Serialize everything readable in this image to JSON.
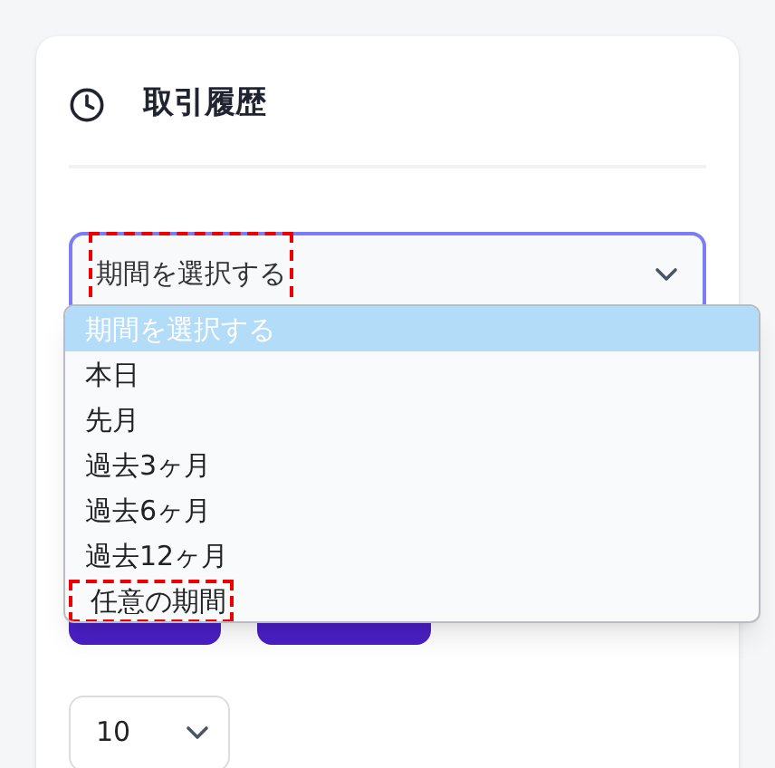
{
  "card": {
    "title": "取引履歴"
  },
  "period_select": {
    "value": "期間を選択する",
    "focused": true,
    "annotated": true
  },
  "period_options": [
    {
      "label": "期間を選択する",
      "selected": true,
      "annotated": false
    },
    {
      "label": "本日",
      "selected": false,
      "annotated": false
    },
    {
      "label": "先月",
      "selected": false,
      "annotated": false
    },
    {
      "label": "過去3ヶ月",
      "selected": false,
      "annotated": false
    },
    {
      "label": "過去6ヶ月",
      "selected": false,
      "annotated": false
    },
    {
      "label": "過去12ヶ月",
      "selected": false,
      "annotated": false
    },
    {
      "label": "任意の期間",
      "selected": false,
      "annotated": true
    }
  ],
  "page_size_select": {
    "value": "10"
  }
}
